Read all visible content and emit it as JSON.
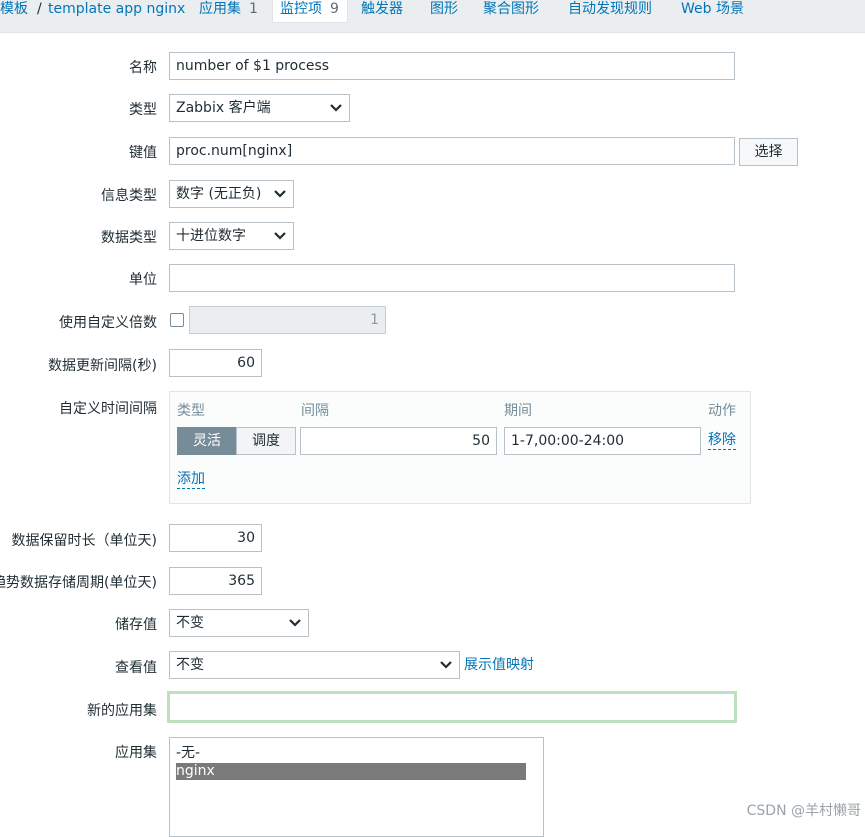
{
  "nav": {
    "templates": "模板",
    "sep": "/",
    "template_name": "template app nginx",
    "applications": "应用集",
    "applications_count": "1",
    "items": "监控项",
    "items_count": "9",
    "triggers": "触发器",
    "graphs": "图形",
    "screens": "聚合图形",
    "discovery": "自动发现规则",
    "web": "Web 场景"
  },
  "form": {
    "name_label": "名称",
    "name_value": "number of $1 process",
    "type_label": "类型",
    "type_value": "Zabbix 客户端",
    "key_label": "键值",
    "key_value": "proc.num[nginx]",
    "select_button": "选择",
    "info_type_label": "信息类型",
    "info_type_value": "数字 (无正负)",
    "data_type_label": "数据类型",
    "data_type_value": "十进位数字",
    "units_label": "单位",
    "units_value": "",
    "multiplier_label": "使用自定义倍数",
    "multiplier_value": "1",
    "interval_label": "数据更新间隔(秒)",
    "interval_value": "60",
    "custom_interval_label": "自定义时间间隔",
    "custom": {
      "col_type": "类型",
      "col_interval": "间隔",
      "col_period": "期间",
      "col_action": "动作",
      "flexible": "灵活",
      "scheduling": "调度",
      "interval_value": "50",
      "period_value": "1-7,00:00-24:00",
      "remove": "移除",
      "add": "添加"
    },
    "history_label": "数据保留时长（单位天)",
    "history_value": "30",
    "trends_label": "趋势数据存储周期(单位天)",
    "trends_value": "365",
    "store_label": "储存值",
    "store_value": "不变",
    "show_label": "查看值",
    "show_value": "不变",
    "show_mappings": "展示值映射",
    "new_app_label": "新的应用集",
    "new_app_value": "",
    "apps_label": "应用集",
    "apps_options": [
      "-无-",
      "nginx"
    ]
  },
  "watermark": "CSDN @羊村懒哥"
}
